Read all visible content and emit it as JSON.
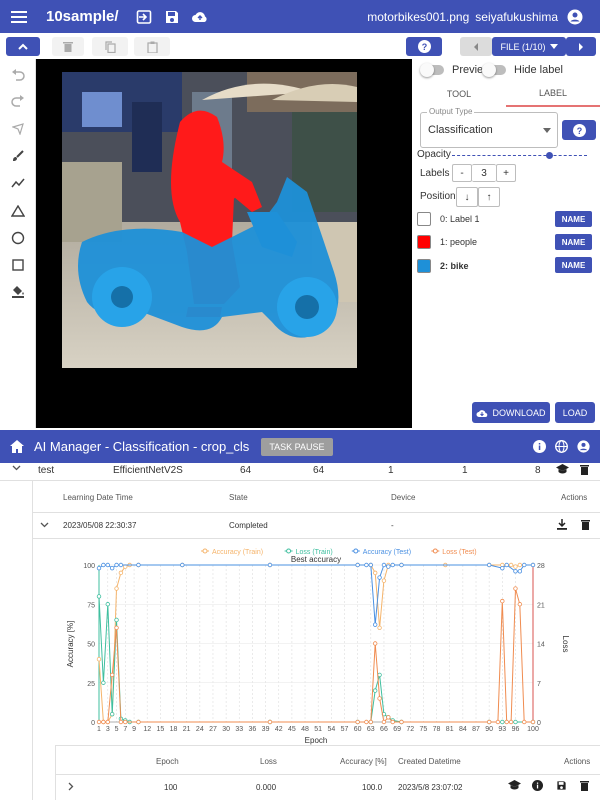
{
  "app": {
    "title": "10sample/",
    "filename": "motorbikes001.png",
    "username": "seiyafukushima"
  },
  "toolbar": {
    "file_label": "FILE (1/10)"
  },
  "panel": {
    "preview_label": "Preview",
    "hide_label": "Hide label",
    "tabs": [
      "TOOL",
      "LABEL"
    ],
    "output_type_label": "Output Type",
    "output_type_value": "Classification",
    "opacity_label": "Opacity",
    "opacity_value": 0.72,
    "labels_label": "Labels",
    "labels_minus": "-",
    "labels_count": "3",
    "labels_plus": "+",
    "position_label": "Position",
    "position_down": "↓",
    "position_up": "↑",
    "label_items": [
      {
        "text": "0: Label 1",
        "color": "#ffffff",
        "bold": false
      },
      {
        "text": "1: people",
        "color": "#ff0000",
        "bold": false
      },
      {
        "text": "2: bike",
        "color": "#1e90d8",
        "bold": true
      }
    ],
    "name_button": "NAME",
    "download_label": "DOWNLOAD",
    "load_label": "LOAD"
  },
  "ai": {
    "title": "AI Manager - Classification - crop_cls",
    "task_button": "TASK PAUSE",
    "model_row": [
      "test",
      "EfficientNetV2S",
      "64",
      "64",
      "1",
      "1",
      "8"
    ],
    "headers": [
      "Learning Date Time",
      "State",
      "Device",
      "Actions"
    ],
    "run_row": [
      "2023/05/08 22:30:37",
      "Completed",
      "-"
    ],
    "epoch_headers": [
      "Epoch",
      "Loss",
      "Accuracy [%]",
      "Created Datetime",
      "Actions"
    ],
    "epoch_row": [
      "100",
      "0.000",
      "100.0",
      "2023/5/8 23:07:02"
    ]
  },
  "chart_data": {
    "type": "line",
    "legend": [
      "Accuracy (Train)",
      "Loss (Train)",
      "Accuracy (Test)",
      "Loss (Test)"
    ],
    "annotation": "Best accuracy",
    "xlabel": "Epoch",
    "ylabel": "Accuracy [%]",
    "y2label": "Loss",
    "x_ticks": [
      "1",
      "3",
      "5",
      "7",
      "9",
      "12",
      "15",
      "18",
      "21",
      "24",
      "27",
      "30",
      "33",
      "36",
      "39",
      "42",
      "45",
      "48",
      "51",
      "54",
      "57",
      "60",
      "63",
      "66",
      "69",
      "72",
      "75",
      "78",
      "81",
      "84",
      "87",
      "90",
      "93",
      "96",
      "100"
    ],
    "y_ticks": [
      "0",
      "25",
      "50",
      "75",
      "100"
    ],
    "y2_ticks": [
      "0",
      "7",
      "14",
      "21",
      "28"
    ],
    "ylim": [
      0,
      100
    ],
    "y2lim": [
      0,
      28
    ],
    "xlim": [
      1,
      100
    ],
    "colors": [
      "#f5b46b",
      "#3fbf9f",
      "#4a90e2",
      "#f08c50"
    ],
    "series": [
      {
        "name": "Accuracy (Train)",
        "axis": "left",
        "points": [
          [
            1,
            40
          ],
          [
            2,
            0
          ],
          [
            3,
            0
          ],
          [
            4,
            5
          ],
          [
            5,
            85
          ],
          [
            6,
            95
          ],
          [
            7,
            99
          ],
          [
            8,
            100
          ],
          [
            10,
            100
          ],
          [
            20,
            100
          ],
          [
            40,
            100
          ],
          [
            60,
            100
          ],
          [
            63,
            100
          ],
          [
            64,
            95
          ],
          [
            65,
            60
          ],
          [
            66,
            90
          ],
          [
            67,
            100
          ],
          [
            70,
            100
          ],
          [
            80,
            100
          ],
          [
            90,
            100
          ],
          [
            93,
            100
          ],
          [
            95,
            100
          ],
          [
            96,
            99
          ],
          [
            97,
            100
          ],
          [
            100,
            100
          ]
        ]
      },
      {
        "name": "Loss (Train)",
        "axis": "left",
        "points": [
          [
            1,
            80
          ],
          [
            2,
            25
          ],
          [
            3,
            75
          ],
          [
            4,
            5
          ],
          [
            5,
            65
          ],
          [
            6,
            2
          ],
          [
            7,
            1
          ],
          [
            8,
            0
          ],
          [
            10,
            0
          ],
          [
            40,
            0
          ],
          [
            60,
            0
          ],
          [
            63,
            0
          ],
          [
            64,
            20
          ],
          [
            65,
            30
          ],
          [
            66,
            5
          ],
          [
            67,
            3
          ],
          [
            68,
            1
          ],
          [
            70,
            0
          ],
          [
            90,
            0
          ],
          [
            93,
            0
          ],
          [
            96,
            0
          ],
          [
            100,
            0
          ]
        ]
      },
      {
        "name": "Accuracy (Test)",
        "axis": "left",
        "points": [
          [
            1,
            98
          ],
          [
            2,
            100
          ],
          [
            3,
            100
          ],
          [
            4,
            98
          ],
          [
            5,
            100
          ],
          [
            6,
            100
          ],
          [
            10,
            100
          ],
          [
            20,
            100
          ],
          [
            40,
            100
          ],
          [
            60,
            100
          ],
          [
            62,
            100
          ],
          [
            63,
            100
          ],
          [
            64,
            62
          ],
          [
            65,
            92
          ],
          [
            66,
            100
          ],
          [
            67,
            99
          ],
          [
            68,
            100
          ],
          [
            70,
            100
          ],
          [
            90,
            100
          ],
          [
            93,
            98
          ],
          [
            94,
            100
          ],
          [
            96,
            96
          ],
          [
            97,
            96
          ],
          [
            98,
            100
          ],
          [
            100,
            100
          ]
        ]
      },
      {
        "name": "Loss (Test)",
        "axis": "left",
        "points": [
          [
            1,
            0
          ],
          [
            2,
            0
          ],
          [
            3,
            0
          ],
          [
            4,
            30
          ],
          [
            5,
            60
          ],
          [
            6,
            0
          ],
          [
            7,
            0
          ],
          [
            10,
            0
          ],
          [
            40,
            0
          ],
          [
            60,
            0
          ],
          [
            62,
            0
          ],
          [
            63,
            0
          ],
          [
            64,
            50
          ],
          [
            65,
            15
          ],
          [
            66,
            0
          ],
          [
            67,
            3
          ],
          [
            68,
            0
          ],
          [
            70,
            0
          ],
          [
            90,
            0
          ],
          [
            92,
            0
          ],
          [
            93,
            77
          ],
          [
            94,
            0
          ],
          [
            95,
            0
          ],
          [
            96,
            85
          ],
          [
            97,
            75
          ],
          [
            98,
            0
          ],
          [
            100,
            0
          ]
        ]
      }
    ]
  }
}
